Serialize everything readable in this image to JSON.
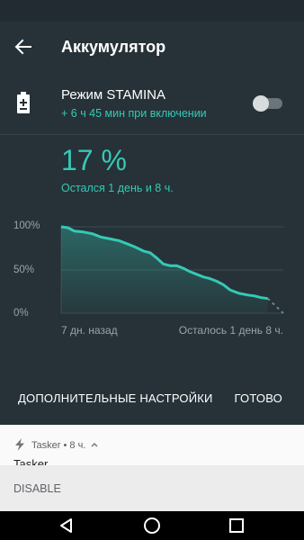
{
  "header": {
    "title": "Аккумулятор"
  },
  "stamina": {
    "title": "Режим STAMINA",
    "subtitle": "+ 6 ч 45 мин при включении",
    "toggle_on": false
  },
  "battery": {
    "percent": "17 %",
    "remaining": "Остался 1 день и 8 ч."
  },
  "chart_data": {
    "type": "line",
    "y_tick_labels": [
      "100%",
      "50%",
      "0%"
    ],
    "ylim": [
      0,
      100
    ],
    "xlim": [
      0,
      100
    ],
    "x_label_left": "7 дн. назад",
    "x_label_right": "Осталось 1 день 8 ч.",
    "grid": true,
    "series": [
      {
        "values": [
          [
            0,
            100
          ],
          [
            3,
            99
          ],
          [
            6,
            95
          ],
          [
            10,
            94
          ],
          [
            14,
            92
          ],
          [
            18,
            88
          ],
          [
            22,
            86
          ],
          [
            26,
            84
          ],
          [
            30,
            80
          ],
          [
            33,
            77
          ],
          [
            37,
            72
          ],
          [
            40,
            70
          ],
          [
            43,
            64
          ],
          [
            46,
            57
          ],
          [
            49,
            55
          ],
          [
            52,
            55
          ],
          [
            55,
            52
          ],
          [
            58,
            48
          ],
          [
            61,
            45
          ],
          [
            64,
            42
          ],
          [
            67,
            40
          ],
          [
            70,
            37
          ],
          [
            73,
            33
          ],
          [
            76,
            27
          ],
          [
            80,
            23
          ],
          [
            84,
            21
          ],
          [
            87,
            20
          ],
          [
            90,
            18
          ],
          [
            93,
            17
          ]
        ]
      },
      {
        "style": "dotted",
        "values": [
          [
            93,
            17
          ],
          [
            100,
            0
          ]
        ]
      }
    ],
    "line_color": "#35c9b6"
  },
  "actions": {
    "advanced": "ДОПОЛНИТЕЛЬНЫЕ НАСТРОЙКИ",
    "done": "ГОТОВО"
  },
  "notification": {
    "app": "Tasker",
    "time": "8 ч.",
    "title": "Tasker",
    "action": "DISABLE",
    "icon": "bolt-icon"
  },
  "nav": {
    "icons": [
      "back-triangle-icon",
      "home-circle-icon",
      "recents-square-icon"
    ]
  },
  "colors": {
    "background": "#263238",
    "accent": "#35c9b6"
  }
}
